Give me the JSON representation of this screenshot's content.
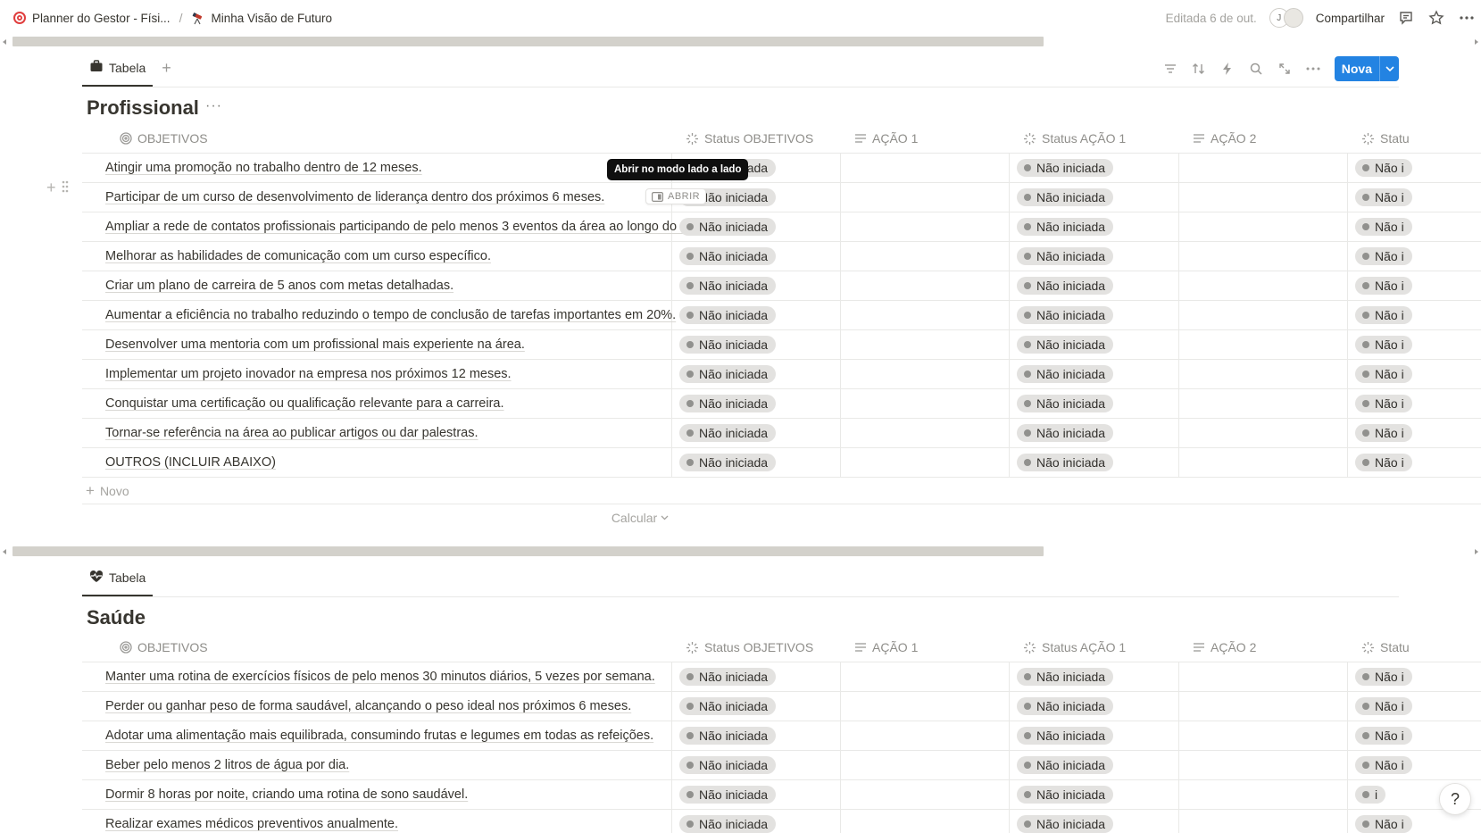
{
  "topbar": {
    "breadcrumb_1": "Planner do Gestor - Físi...",
    "breadcrumb_2": "Minha Visão de Futuro",
    "separator": "/",
    "edited": "Editada 6 de out.",
    "avatar_initial": "J",
    "share_label": "Compartilhar"
  },
  "sections": [
    {
      "view_tab": "Tabela",
      "title": "Profissional",
      "more": "···",
      "new_button": "Nova",
      "columns": {
        "objetivos": "OBJETIVOS",
        "status_objetivos": "Status OBJETIVOS",
        "acao1": "AÇÃO 1",
        "status_acao1": "Status AÇÃO 1",
        "acao2": "AÇÃO 2",
        "status_cut": "Statu"
      },
      "rows": [
        {
          "objetivo": "Atingir uma promoção no trabalho dentro de 12 meses.",
          "status": "Não iniciada",
          "status_acao1": "Não iniciada",
          "status_cut": "Não i"
        },
        {
          "objetivo": "Participar de um curso de desenvolvimento de liderança dentro dos próximos 6 meses.",
          "status": "Não iniciada",
          "status_acao1": "Não iniciada",
          "status_cut": "Não i"
        },
        {
          "objetivo": "Ampliar a rede de contatos profissionais participando de pelo menos 3 eventos da área ao longo do ano.",
          "status": "Não iniciada",
          "status_acao1": "Não iniciada",
          "status_cut": "Não i"
        },
        {
          "objetivo": "Melhorar as habilidades de comunicação com um curso específico.",
          "status": "Não iniciada",
          "status_acao1": "Não iniciada",
          "status_cut": "Não i"
        },
        {
          "objetivo": "Criar um plano de carreira de 5 anos com metas detalhadas.",
          "status": "Não iniciada",
          "status_acao1": "Não iniciada",
          "status_cut": "Não i"
        },
        {
          "objetivo": "Aumentar a eficiência no trabalho reduzindo o tempo de conclusão de tarefas importantes em 20%.",
          "status": "Não iniciada",
          "status_acao1": "Não iniciada",
          "status_cut": "Não i"
        },
        {
          "objetivo": "Desenvolver uma mentoria com um profissional mais experiente na área.",
          "status": "Não iniciada",
          "status_acao1": "Não iniciada",
          "status_cut": "Não i"
        },
        {
          "objetivo": "Implementar um projeto inovador na empresa nos próximos 12 meses.",
          "status": "Não iniciada",
          "status_acao1": "Não iniciada",
          "status_cut": "Não i"
        },
        {
          "objetivo": "Conquistar uma certificação ou qualificação relevante para a carreira.",
          "status": "Não iniciada",
          "status_acao1": "Não iniciada",
          "status_cut": "Não i"
        },
        {
          "objetivo": "Tornar-se referência na área ao publicar artigos ou dar palestras.",
          "status": "Não iniciada",
          "status_acao1": "Não iniciada",
          "status_cut": "Não i"
        },
        {
          "objetivo": "OUTROS (INCLUIR ABAIXO)",
          "status": "Não iniciada",
          "status_acao1": "Não iniciada",
          "status_cut": "Não i"
        }
      ],
      "add_row": "Novo",
      "calculate": "Calcular",
      "tooltip": "Abrir no modo lado a lado",
      "open_button": "ABRIR"
    },
    {
      "view_tab": "Tabela",
      "title": "Saúde",
      "columns": {
        "objetivos": "OBJETIVOS",
        "status_objetivos": "Status OBJETIVOS",
        "acao1": "AÇÃO 1",
        "status_acao1": "Status AÇÃO 1",
        "acao2": "AÇÃO 2",
        "status_cut": "Statu"
      },
      "rows": [
        {
          "objetivo": "Manter uma rotina de exercícios físicos de pelo menos 30 minutos diários, 5 vezes por semana.",
          "status": "Não iniciada",
          "status_acao1": "Não iniciada",
          "status_cut": "Não i"
        },
        {
          "objetivo": "Perder ou ganhar peso de forma saudável, alcançando o peso ideal nos próximos 6 meses.",
          "status": "Não iniciada",
          "status_acao1": "Não iniciada",
          "status_cut": "Não i"
        },
        {
          "objetivo": "Adotar uma alimentação mais equilibrada, consumindo frutas e legumes em todas as refeições.",
          "status": "Não iniciada",
          "status_acao1": "Não iniciada",
          "status_cut": "Não i"
        },
        {
          "objetivo": "Beber pelo menos 2 litros de água por dia.",
          "status": "Não iniciada",
          "status_acao1": "Não iniciada",
          "status_cut": "Não i"
        },
        {
          "objetivo": "Dormir 8 horas por noite, criando uma rotina de sono saudável.",
          "status": "Não iniciada",
          "status_acao1": "Não iniciada",
          "status_cut": "i"
        },
        {
          "objetivo": "Realizar exames médicos preventivos anualmente.",
          "status": "Não iniciada",
          "status_acao1": "Não iniciada",
          "status_cut": "Não i"
        }
      ]
    }
  ],
  "colors": {
    "accent": "#2383e2",
    "pill_bg": "#e3e2e0",
    "pill_dot": "#91918e",
    "text": "#37352f",
    "muted": "#8f8e8a"
  }
}
